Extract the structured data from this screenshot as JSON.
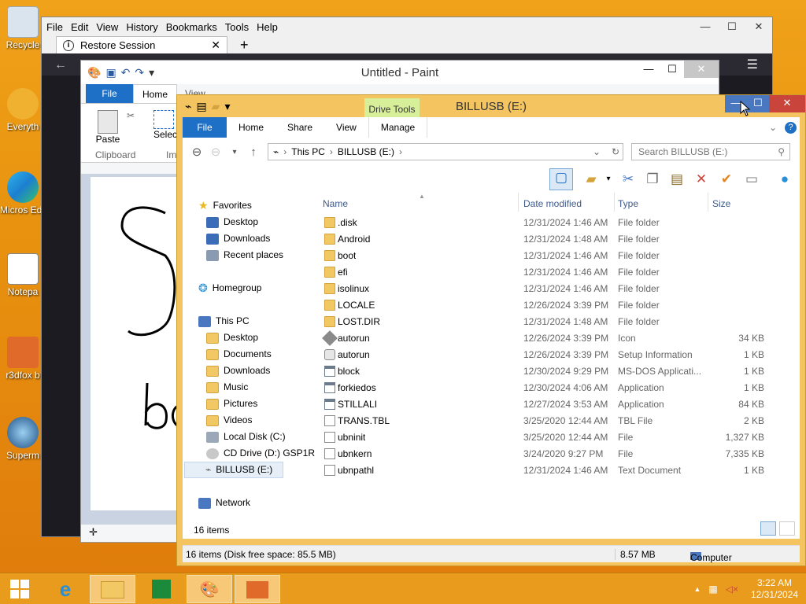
{
  "desktop": {
    "icons": [
      "Recycle",
      "Everyth",
      "Micros Edge",
      "Notepa",
      "r3dfox b",
      "Superm"
    ]
  },
  "firefox": {
    "menus": [
      "File",
      "Edit",
      "View",
      "History",
      "Bookmarks",
      "Tools",
      "Help"
    ],
    "tab_title": "Restore Session",
    "tab_close": "✕",
    "new_tab": "+",
    "min": "—",
    "max": "☐",
    "close": "✕"
  },
  "paint": {
    "title": "Untitled - Paint",
    "tabs": {
      "file": "File",
      "home": "Home",
      "view": "View"
    },
    "paste_label": "Paste",
    "select_label": "Select",
    "clipboard_group": "Clipboard",
    "image_group": "Im",
    "min": "—",
    "max": "☐",
    "close": "✕",
    "help": "?"
  },
  "explorer": {
    "title": "BILLUSB (E:)",
    "drive_tools": "Drive Tools",
    "tabs": {
      "file": "File",
      "home": "Home",
      "share": "Share",
      "view": "View",
      "manage": "Manage"
    },
    "address": {
      "root": "This PC",
      "drive": "BILLUSB (E:)"
    },
    "search_placeholder": "Search BILLUSB (E:)",
    "columns": {
      "name": "Name",
      "date": "Date modified",
      "type": "Type",
      "size": "Size"
    },
    "nav": {
      "favorites": "Favorites",
      "fav_items": [
        "Desktop",
        "Downloads",
        "Recent places"
      ],
      "homegroup": "Homegroup",
      "thispc": "This PC",
      "pc_items": [
        "Desktop",
        "Documents",
        "Downloads",
        "Music",
        "Pictures",
        "Videos",
        "Local Disk (C:)",
        "CD Drive (D:) GSP1R",
        "BILLUSB (E:)"
      ],
      "network": "Network"
    },
    "files": [
      {
        "name": ".disk",
        "date": "12/31/2024 1:46 AM",
        "type": "File folder",
        "size": "",
        "icon": "folder"
      },
      {
        "name": "Android",
        "date": "12/31/2024 1:48 AM",
        "type": "File folder",
        "size": "",
        "icon": "folder"
      },
      {
        "name": "boot",
        "date": "12/31/2024 1:46 AM",
        "type": "File folder",
        "size": "",
        "icon": "folder"
      },
      {
        "name": "efi",
        "date": "12/31/2024 1:46 AM",
        "type": "File folder",
        "size": "",
        "icon": "folder"
      },
      {
        "name": "isolinux",
        "date": "12/31/2024 1:46 AM",
        "type": "File folder",
        "size": "",
        "icon": "folder"
      },
      {
        "name": "LOCALE",
        "date": "12/26/2024 3:39 PM",
        "type": "File folder",
        "size": "",
        "icon": "folder"
      },
      {
        "name": "LOST.DIR",
        "date": "12/31/2024 1:48 AM",
        "type": "File folder",
        "size": "",
        "icon": "folder"
      },
      {
        "name": "autorun",
        "date": "12/26/2024 3:39 PM",
        "type": "Icon",
        "size": "34 KB",
        "icon": "icon"
      },
      {
        "name": "autorun",
        "date": "12/26/2024 3:39 PM",
        "type": "Setup Information",
        "size": "1 KB",
        "icon": "gear"
      },
      {
        "name": "block",
        "date": "12/30/2024 9:29 PM",
        "type": "MS-DOS Applicati...",
        "size": "1 KB",
        "icon": "app"
      },
      {
        "name": "forkiedos",
        "date": "12/30/2024 4:06 AM",
        "type": "Application",
        "size": "1 KB",
        "icon": "app"
      },
      {
        "name": "STILLALI",
        "date": "12/27/2024 3:53 AM",
        "type": "Application",
        "size": "84 KB",
        "icon": "app"
      },
      {
        "name": "TRANS.TBL",
        "date": "3/25/2020 12:44 AM",
        "type": "TBL File",
        "size": "2 KB",
        "icon": "file"
      },
      {
        "name": "ubninit",
        "date": "3/25/2020 12:44 AM",
        "type": "File",
        "size": "1,327 KB",
        "icon": "file"
      },
      {
        "name": "ubnkern",
        "date": "3/24/2020 9:27 PM",
        "type": "File",
        "size": "7,335 KB",
        "icon": "file"
      },
      {
        "name": "ubnpathl",
        "date": "12/31/2024 1:46 AM",
        "type": "Text Document",
        "size": "1 KB",
        "icon": "file"
      }
    ],
    "item_count": "16 items",
    "status_free": "16 items (Disk free space: 85.5 MB)",
    "status_size": "8.57 MB",
    "status_location": "Computer",
    "min": "—",
    "max": "☐",
    "close": "✕"
  },
  "taskbar": {
    "time": "3:22 AM",
    "date": "12/31/2024"
  },
  "colors": {
    "desktop": "#e8920f",
    "explorer_frame": "#f3c45f",
    "accent_blue": "#1e6fc6",
    "close_red": "#c9453b"
  }
}
